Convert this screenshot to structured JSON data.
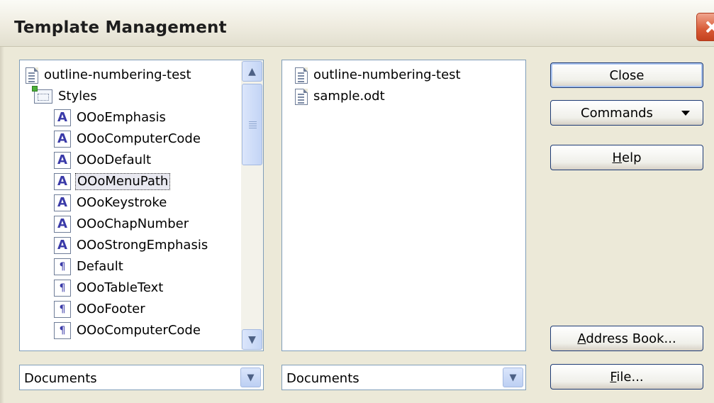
{
  "window": {
    "title": "Template Management"
  },
  "left_list": {
    "items": [
      {
        "label": "outline-numbering-test",
        "icon": "document-icon"
      },
      {
        "label": "Styles",
        "icon": "styles-folder-icon"
      },
      {
        "label": "OOoEmphasis",
        "icon": "character-style-icon"
      },
      {
        "label": "OOoComputerCode",
        "icon": "character-style-icon"
      },
      {
        "label": "OOoDefault",
        "icon": "character-style-icon"
      },
      {
        "label": "OOoMenuPath",
        "icon": "character-style-icon",
        "selected": true
      },
      {
        "label": "OOoKeystroke",
        "icon": "character-style-icon"
      },
      {
        "label": "OOoChapNumber",
        "icon": "character-style-icon"
      },
      {
        "label": "OOoStrongEmphasis",
        "icon": "character-style-icon"
      },
      {
        "label": "Default",
        "icon": "paragraph-style-icon"
      },
      {
        "label": "OOoTableText",
        "icon": "paragraph-style-icon"
      },
      {
        "label": "OOoFooter",
        "icon": "paragraph-style-icon"
      },
      {
        "label": "OOoComputerCode",
        "icon": "paragraph-style-icon"
      }
    ],
    "glyph_char": "A",
    "glyph_para": "¶"
  },
  "right_list": {
    "items": [
      {
        "label": "outline-numbering-test",
        "icon": "document-icon"
      },
      {
        "label": "sample.odt",
        "icon": "document-icon"
      }
    ]
  },
  "buttons": {
    "close": "Close",
    "commands": "Commands",
    "help_mnemonic": "H",
    "help_rest": "elp",
    "address_mnemonic": "A",
    "address_rest": "ddress Book...",
    "file_mnemonic": "F",
    "file_rest": "ile..."
  },
  "combos": {
    "left_value": "Documents",
    "right_value": "Documents"
  }
}
